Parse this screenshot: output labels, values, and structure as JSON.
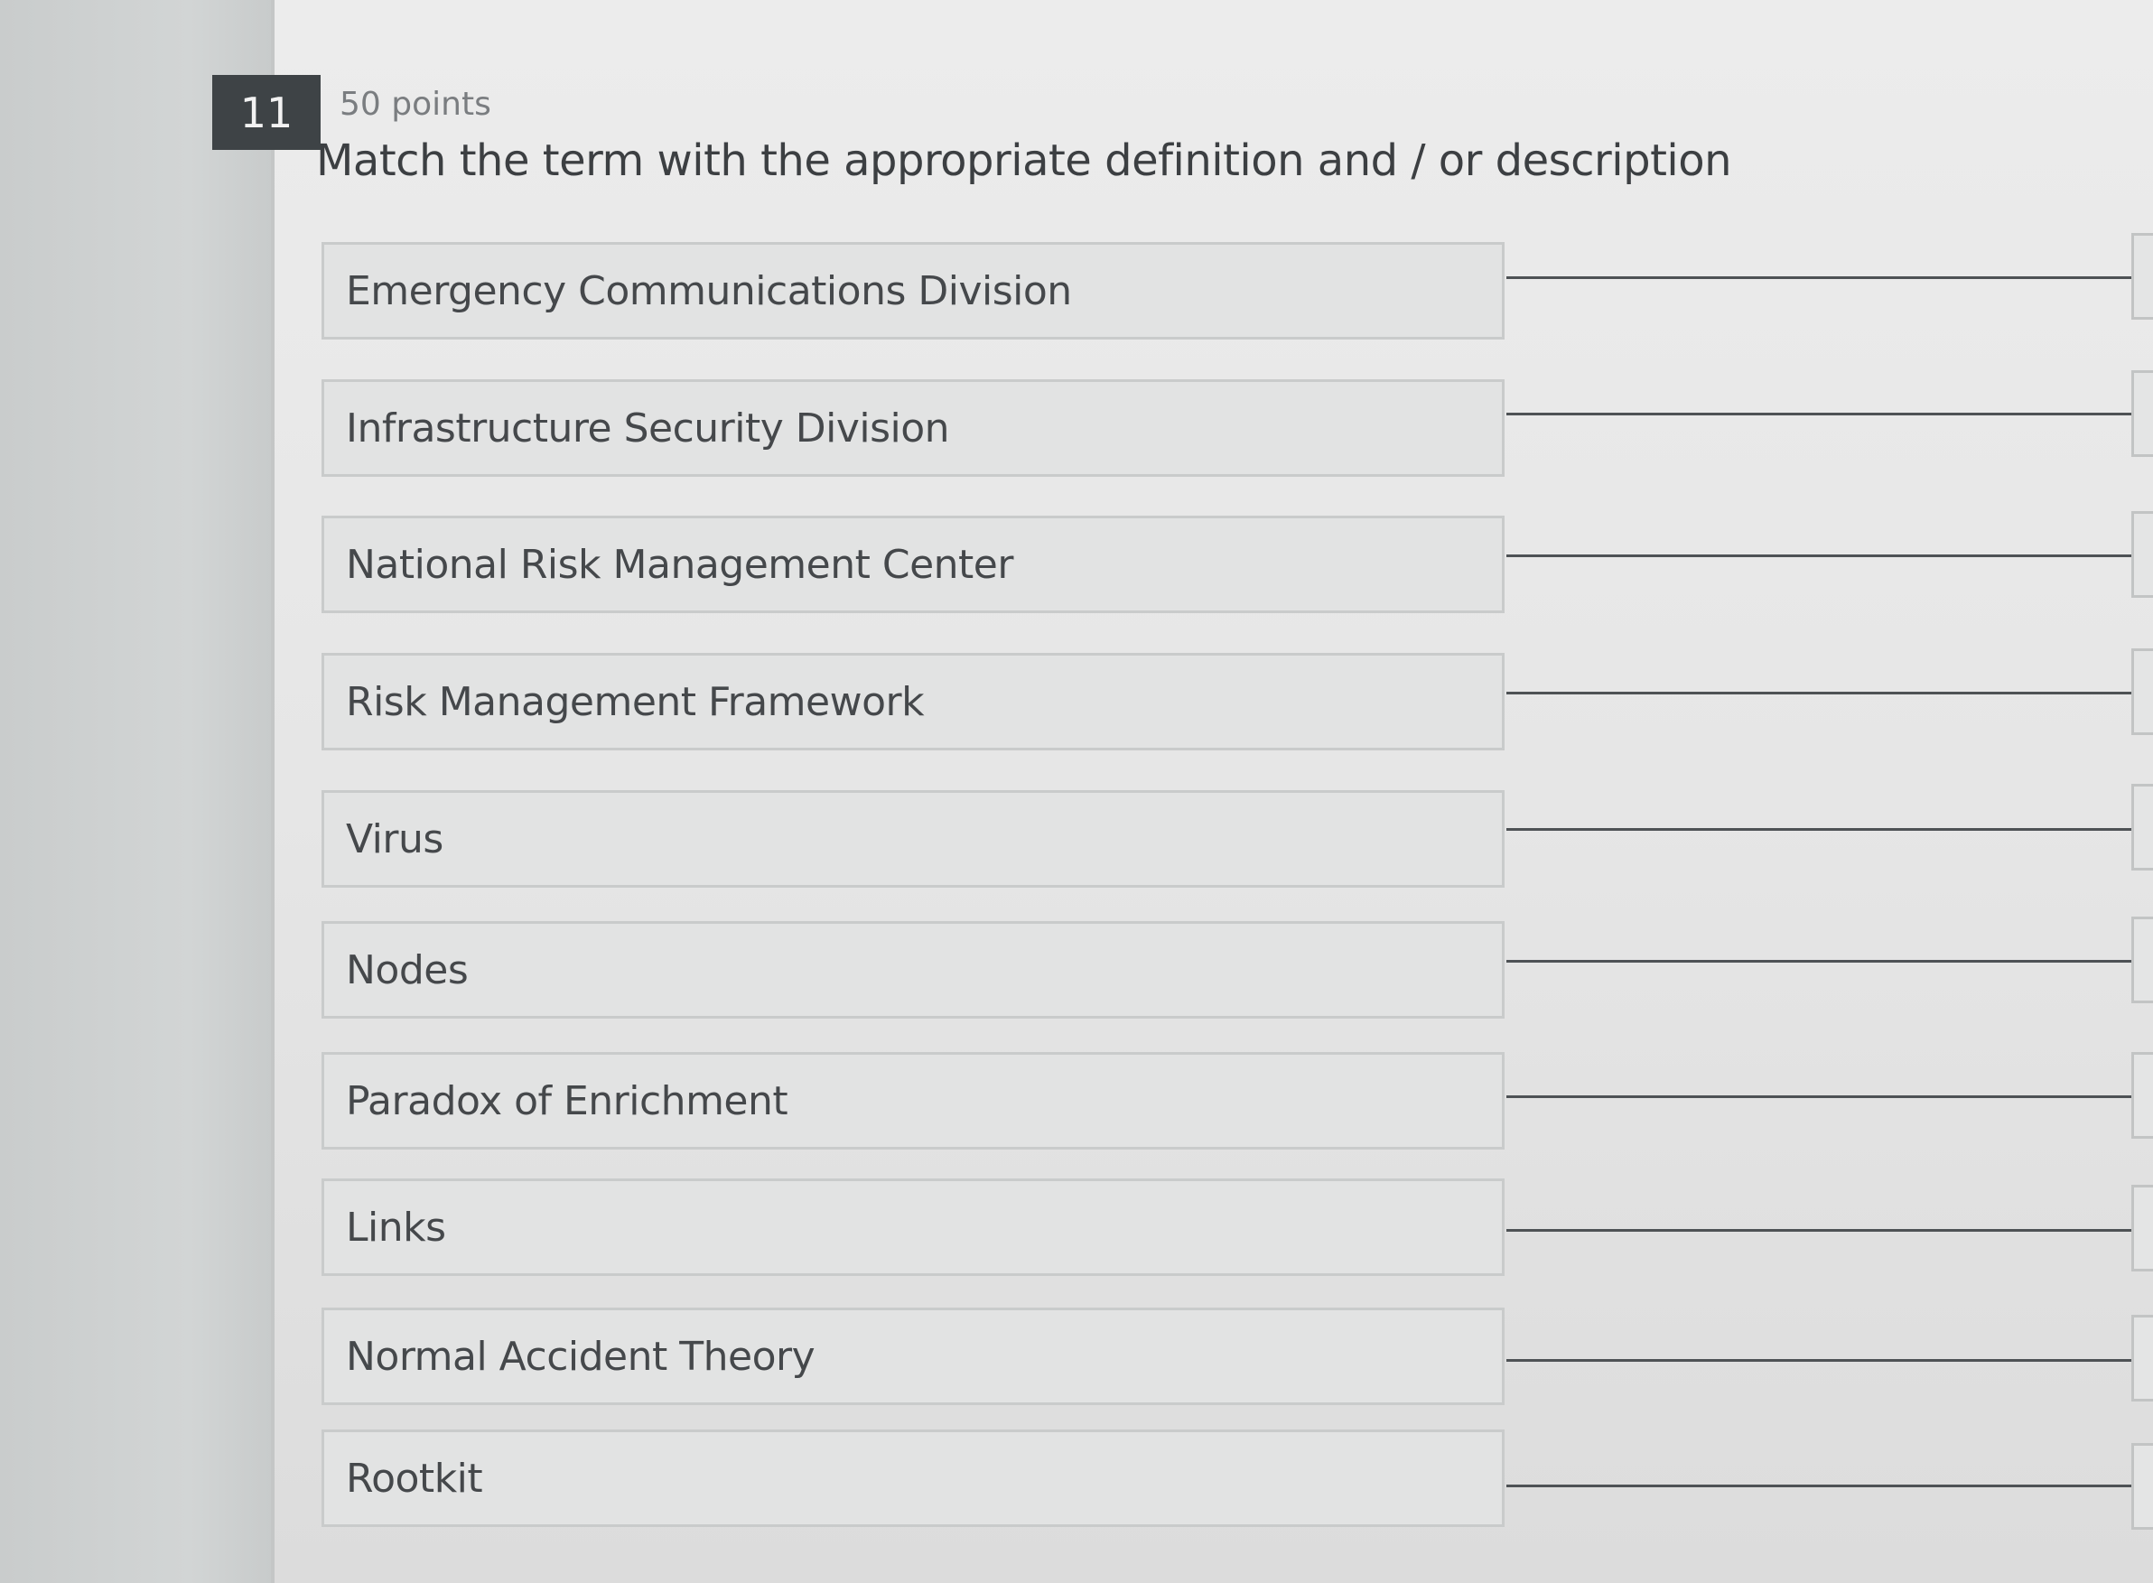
{
  "question": {
    "number": "11",
    "points": "50 points",
    "prompt": "Match the term with the appropriate definition and / or description"
  },
  "terms": [
    {
      "label": "Emergency Communications Division"
    },
    {
      "label": "Infrastructure Security Division"
    },
    {
      "label": "National Risk Management Center"
    },
    {
      "label": "Risk Management Framework"
    },
    {
      "label": "Virus"
    },
    {
      "label": "Nodes"
    },
    {
      "label": "Paradox of Enrichment"
    },
    {
      "label": "Links"
    },
    {
      "label": "Normal Accident Theory"
    },
    {
      "label": "Rootkit"
    }
  ]
}
